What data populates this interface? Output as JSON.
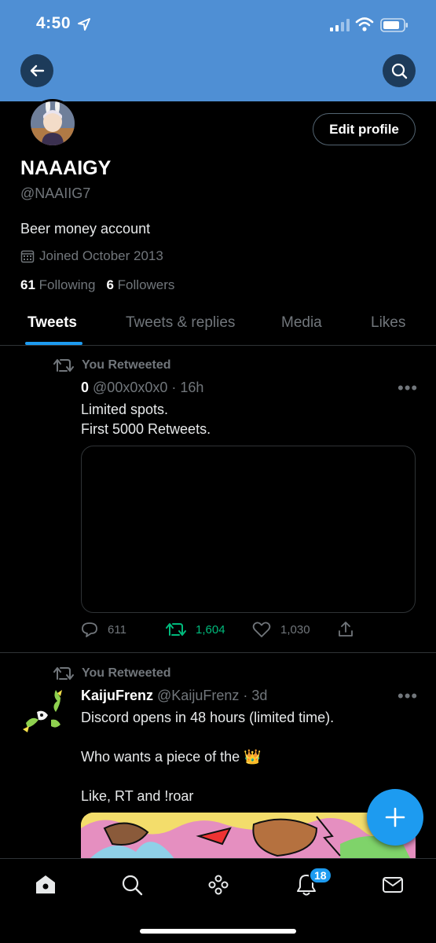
{
  "status_bar": {
    "time": "4:50"
  },
  "profile": {
    "edit_label": "Edit profile",
    "display_name": "NAAAIGY",
    "handle": "@NAAIIG7",
    "bio": "Beer money account",
    "joined": "Joined October 2013",
    "following_count": "61",
    "following_label": "Following",
    "followers_count": "6",
    "followers_label": "Followers"
  },
  "tabs": [
    {
      "label": "Tweets",
      "active": true
    },
    {
      "label": "Tweets & replies",
      "active": false
    },
    {
      "label": "Media",
      "active": false
    },
    {
      "label": "Likes",
      "active": false
    }
  ],
  "tweets": [
    {
      "retweet_label": "You Retweeted",
      "name": "0",
      "meta": "@00x0x0x0 · 16h",
      "text": "Limited spots.\nFirst 5000 Retweets.",
      "replies": "611",
      "retweets": "1,604",
      "likes": "1,030"
    },
    {
      "retweet_label": "You Retweeted",
      "name": "KaijuFrenz",
      "meta": "@KaijuFrenz · 3d",
      "text": "Discord opens in 48 hours (limited time).\n\nWho wants a piece of the 👑\n\nLike, RT and !roar"
    }
  ],
  "more_glyph": "•••",
  "notifications_badge": "18",
  "colors": {
    "header": "#4f8fd4",
    "accent": "#1d9bf0",
    "retweet_green": "#00ba7c"
  }
}
